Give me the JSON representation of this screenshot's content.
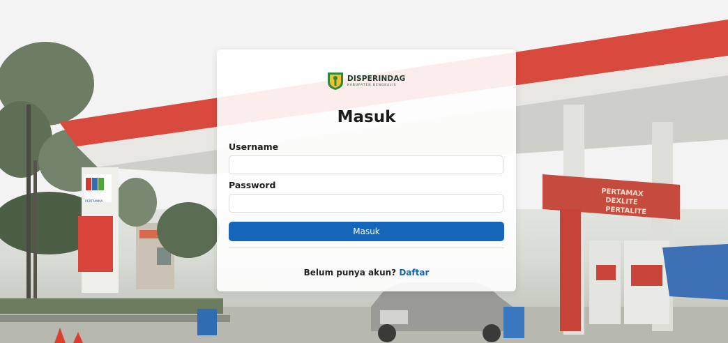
{
  "brand": {
    "name": "DISPERINDAG",
    "subtitle": "KABUPATEN BENGKALIS",
    "accent_color": "#1565b8"
  },
  "login": {
    "title": "Masuk",
    "username_label": "Username",
    "username_value": "",
    "password_label": "Password",
    "password_value": "",
    "submit_label": "Masuk",
    "signup_prompt": "Belum punya akun?",
    "signup_link": "Daftar"
  },
  "background": {
    "pole_brand": "PERTAMINA",
    "pump_sign": [
      "PERTAMAX",
      "DEXLITE",
      "PERTALITE"
    ]
  }
}
